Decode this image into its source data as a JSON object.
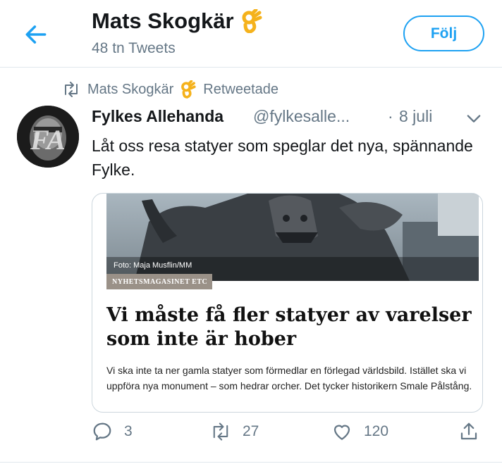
{
  "header": {
    "profile_name": "Mats Skogkär",
    "tweet_count": "48 tn Tweets",
    "follow_label": "Följ",
    "back_icon": "arrow-left-icon",
    "emoji_icon": "ok-hand-emoji"
  },
  "retweet": {
    "retweeter": "Mats Skogkär",
    "action_label": "Retweetade",
    "icon": "retweet-icon"
  },
  "tweet": {
    "author_name": "Fylkes Allehanda",
    "handle": "@fylkesalle...",
    "separator": "·",
    "date": "8 juli",
    "text": "Låt oss resa statyer som speglar det nya, spännande Fylke.",
    "avatar_label": "FA",
    "caret_icon": "chevron-down-icon"
  },
  "card": {
    "photo_credit": "Foto: Maja Musflin/MM",
    "magazine": "NYHETSMAGASINET ETC",
    "title": "Vi måste få fler statyer av varelser som inte är hober",
    "description": "Vi ska inte ta ner gamla statyer som förmedlar en förlegad världsbild. Istället ska vi uppföra nya monument – som hedrar orcher. Det tycker historikern Smale Pålstång."
  },
  "actions": {
    "reply_count": "3",
    "retweet_count": "27",
    "like_count": "120",
    "reply_icon": "reply-icon",
    "retweet_icon": "retweet-icon",
    "like_icon": "heart-icon",
    "share_icon": "share-icon"
  },
  "colors": {
    "accent": "#1da1f2",
    "muted": "#657786",
    "text": "#14171a",
    "border": "#e1e8ed"
  }
}
